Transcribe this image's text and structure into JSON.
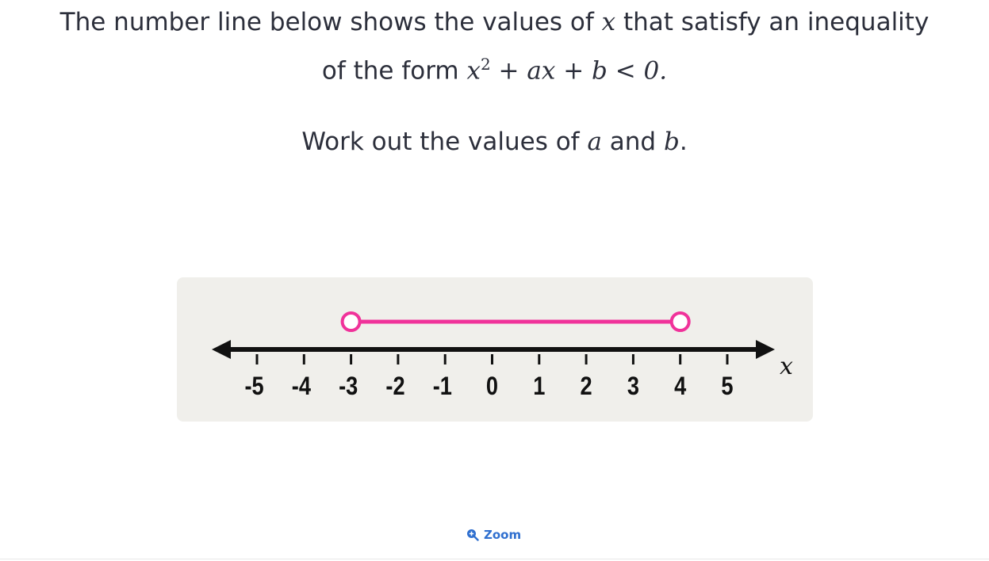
{
  "question": {
    "line1_pre": "The number line below shows the values of ",
    "var_x": "x",
    "line1_post": " that satisfy an inequality",
    "line2_pre": "of the form ",
    "expr_x": "x",
    "expr_exp": "2",
    "expr_rest": " + ax + b < 0.",
    "line3_pre": "Work out the values of ",
    "var_a": "a",
    "and": " and ",
    "var_b": "b",
    "period": "."
  },
  "chart_data": {
    "type": "number-line",
    "range": [
      -5,
      5
    ],
    "tick_labels": [
      "-5",
      "-4",
      "-3",
      "-2",
      "-1",
      "0",
      "1",
      "2",
      "3",
      "4",
      "5"
    ],
    "axis_label": "x",
    "interval": {
      "from": -3,
      "to": 4,
      "left_open": true,
      "right_open": true,
      "color": "#f0329a"
    }
  },
  "zoom_button": {
    "label": "Zoom",
    "icon": "zoom-in-icon"
  }
}
